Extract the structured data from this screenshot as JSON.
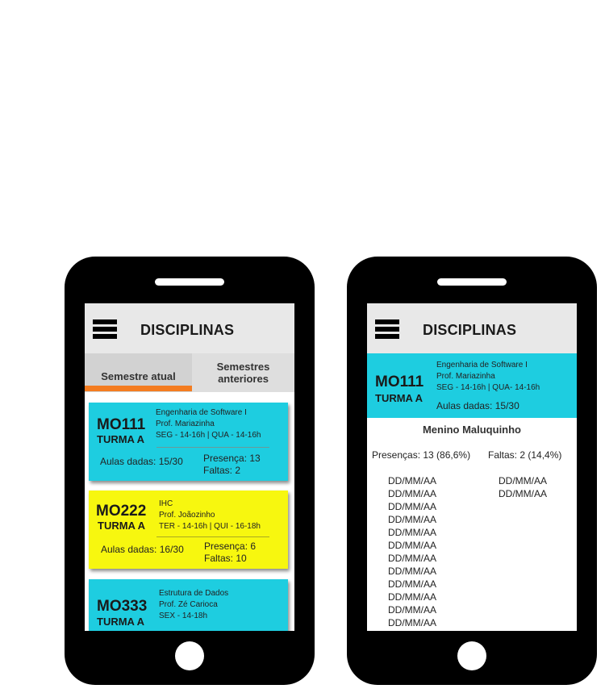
{
  "app": {
    "title": "DISCIPLINAS"
  },
  "tabs": [
    {
      "label": "Semestre atual"
    },
    {
      "label": "Semestres anteriores"
    }
  ],
  "courses": [
    {
      "code": "MO111",
      "turma": "TURMA A",
      "name": "Engenharia de Software I",
      "prof": "Prof. Mariazinha",
      "schedule": "SEG - 14-16h | QUA - 14-16h",
      "aulas": "Aulas dadas: 15/30",
      "presenca": "Presença: 13",
      "faltas": "Faltas: 2",
      "color": "#1ecde0"
    },
    {
      "code": "MO222",
      "turma": "TURMA A",
      "name": "IHC",
      "prof": "Prof. Joãozinho",
      "schedule": "TER - 14-16h | QUI - 16-18h",
      "aulas": "Aulas dadas: 16/30",
      "presenca": "Presença: 6",
      "faltas": "Faltas: 10",
      "color": "#f7f70f"
    },
    {
      "code": "MO333",
      "turma": "TURMA A",
      "name": "Estrutura de Dados",
      "prof": "Prof. Zé Carioca",
      "schedule": "SEX - 14-18h",
      "color": "#1ecde0"
    }
  ],
  "detail": {
    "code": "MO111",
    "turma": "TURMA A",
    "name": "Engenharia de Software I",
    "prof": "Prof. Mariazinha",
    "schedule": "SEG - 14-16h | QUA- 14-16h",
    "aulas": "Aulas dadas: 15/30",
    "student": "Menino Maluquinho",
    "presencas": "Presenças: 13 (86,6%)",
    "faltas": "Faltas: 2 (14,4%)",
    "presence_dates": [
      "DD/MM/AA",
      "DD/MM/AA",
      "DD/MM/AA",
      "DD/MM/AA",
      "DD/MM/AA",
      "DD/MM/AA",
      "DD/MM/AA",
      "DD/MM/AA",
      "DD/MM/AA",
      "DD/MM/AA",
      "DD/MM/AA",
      "DD/MM/AA"
    ],
    "absence_dates": [
      "DD/MM/AA",
      "DD/MM/AA"
    ]
  }
}
